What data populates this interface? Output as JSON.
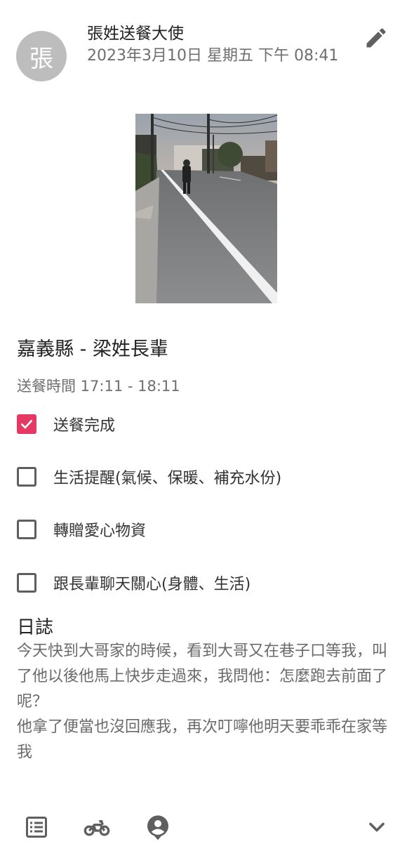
{
  "post": {
    "author_initial": "張",
    "author": "張姓送餐大使",
    "datetime": "2023年3月10日 星期五 下午 08:41"
  },
  "photo": {
    "subject": "elderly man walking on a rural road at dusk"
  },
  "delivery": {
    "title": "嘉義縣 - 梁姓長輩",
    "time": "送餐時間 17:11 - 18:11"
  },
  "tasks": [
    {
      "label": "送餐完成",
      "checked": true
    },
    {
      "label": "生活提醒(氣候、保暖、補充水份)",
      "checked": false
    },
    {
      "label": "轉贈愛心物資",
      "checked": false
    },
    {
      "label": "跟長輩聊天關心(身體、生活)",
      "checked": false
    }
  ],
  "log": {
    "heading": "日誌",
    "body": "今天快到大哥家的時候，看到大哥又在巷子口等我，叫了他以後他馬上快步走過來，我問他：怎麼跑去前面了呢？\n他拿了便當也沒回應我，再次叮嚀他明天要乖乖在家等我"
  },
  "colors": {
    "accent": "#e53863",
    "text_secondary": "#6f6f6f",
    "icon": "#5f5f5f"
  },
  "icons": {
    "edit": "pencil-icon",
    "bottom": [
      "list-icon",
      "motorcycle-icon",
      "person-pin-icon",
      "chevron-down-icon"
    ]
  }
}
